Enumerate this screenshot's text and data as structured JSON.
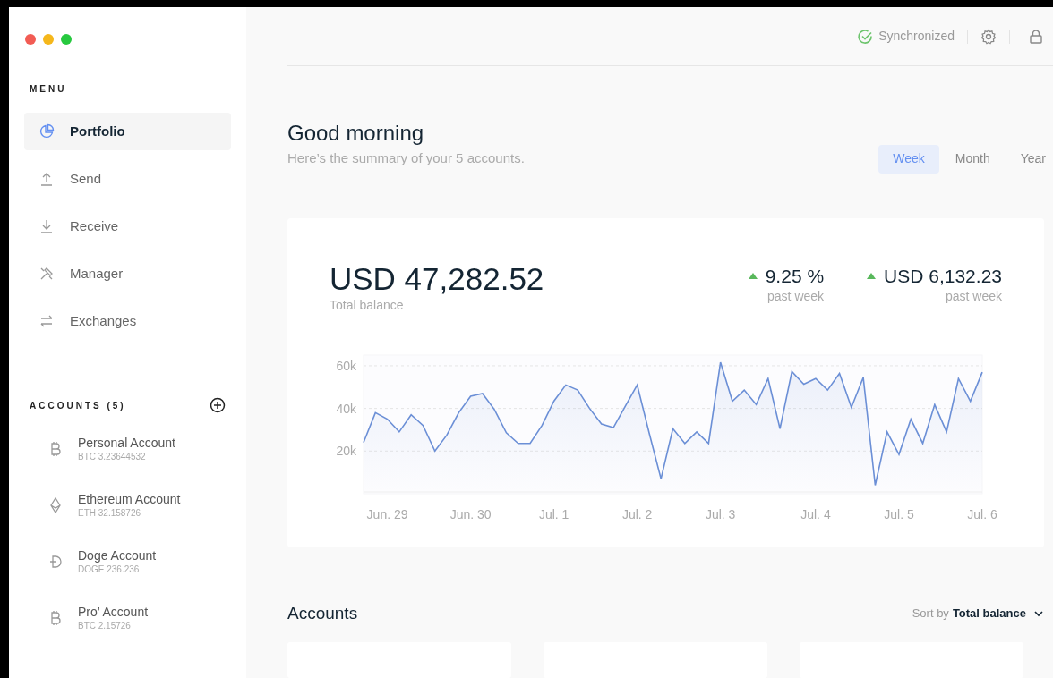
{
  "sidebar": {
    "menu_heading": "MENU",
    "items": [
      {
        "label": "Portfolio",
        "selected": true
      },
      {
        "label": "Send",
        "selected": false
      },
      {
        "label": "Receive",
        "selected": false
      },
      {
        "label": "Manager",
        "selected": false
      },
      {
        "label": "Exchanges",
        "selected": false
      }
    ],
    "accounts_heading": "ACCOUNTS (5)",
    "accounts": [
      {
        "name": "Personal Account",
        "balance": "BTC 3.23644532"
      },
      {
        "name": "Ethereum Account",
        "balance": "ETH 32.158726"
      },
      {
        "name": "Doge Account",
        "balance": "DOGE 236.236"
      },
      {
        "name": "Pro’ Account",
        "balance": "BTC 2.15726"
      }
    ]
  },
  "header": {
    "sync_status": "Synchronized"
  },
  "greeting": {
    "title": "Good morning",
    "subtitle": "Here’s the summary of your 5 accounts."
  },
  "tabs": [
    {
      "label": "Week",
      "selected": true
    },
    {
      "label": "Month",
      "selected": false
    },
    {
      "label": "Year",
      "selected": false
    }
  ],
  "balance_card": {
    "total": "USD 47,282.52",
    "total_caption": "Total balance",
    "stats": [
      {
        "value": "9.25 %",
        "caption": "past week"
      },
      {
        "value": "USD 6,132.23",
        "caption": "past week"
      }
    ],
    "chart_data": {
      "type": "area",
      "categories": [
        null,
        null,
        "Jun. 29",
        null,
        null,
        null,
        null,
        null,
        null,
        "Jun. 30",
        null,
        null,
        null,
        null,
        null,
        null,
        "Jul. 1",
        null,
        null,
        null,
        null,
        null,
        null,
        "Jul. 2",
        null,
        null,
        null,
        null,
        null,
        null,
        "Jul. 3",
        null,
        null,
        null,
        null,
        null,
        null,
        null,
        "Jul. 4",
        null,
        null,
        null,
        null,
        null,
        null,
        "Jul. 5",
        null,
        null,
        null,
        null,
        null,
        null,
        "Jul. 6"
      ],
      "series": [
        {
          "color": "#6b8fd6",
          "values": [
            24,
            38,
            35,
            29,
            37,
            32,
            20,
            27.5,
            38,
            45.7,
            47,
            39.5,
            28.6,
            23.6,
            23.6,
            32,
            43.4,
            51,
            48.6,
            40,
            32.7,
            31,
            41,
            51,
            28.6,
            7,
            30.5,
            23.6,
            29,
            23.6,
            61.6,
            43.4,
            48.6,
            41.8,
            54,
            30.5,
            57.3,
            51.4,
            54,
            48.6,
            56.4,
            40.5,
            54.5,
            4,
            29,
            18.4,
            35,
            23.6,
            41.8,
            29,
            54,
            43.4,
            57
          ]
        }
      ],
      "grid": true,
      "ylim": [
        0,
        65
      ],
      "yticks": [
        {
          "value": 20,
          "label": "20k"
        },
        {
          "value": 40,
          "label": "40k"
        },
        {
          "value": 60,
          "label": "60k"
        }
      ]
    }
  },
  "accounts_section": {
    "title": "Accounts",
    "sort_label": "Sort by",
    "sort_value": "Total balance"
  }
}
